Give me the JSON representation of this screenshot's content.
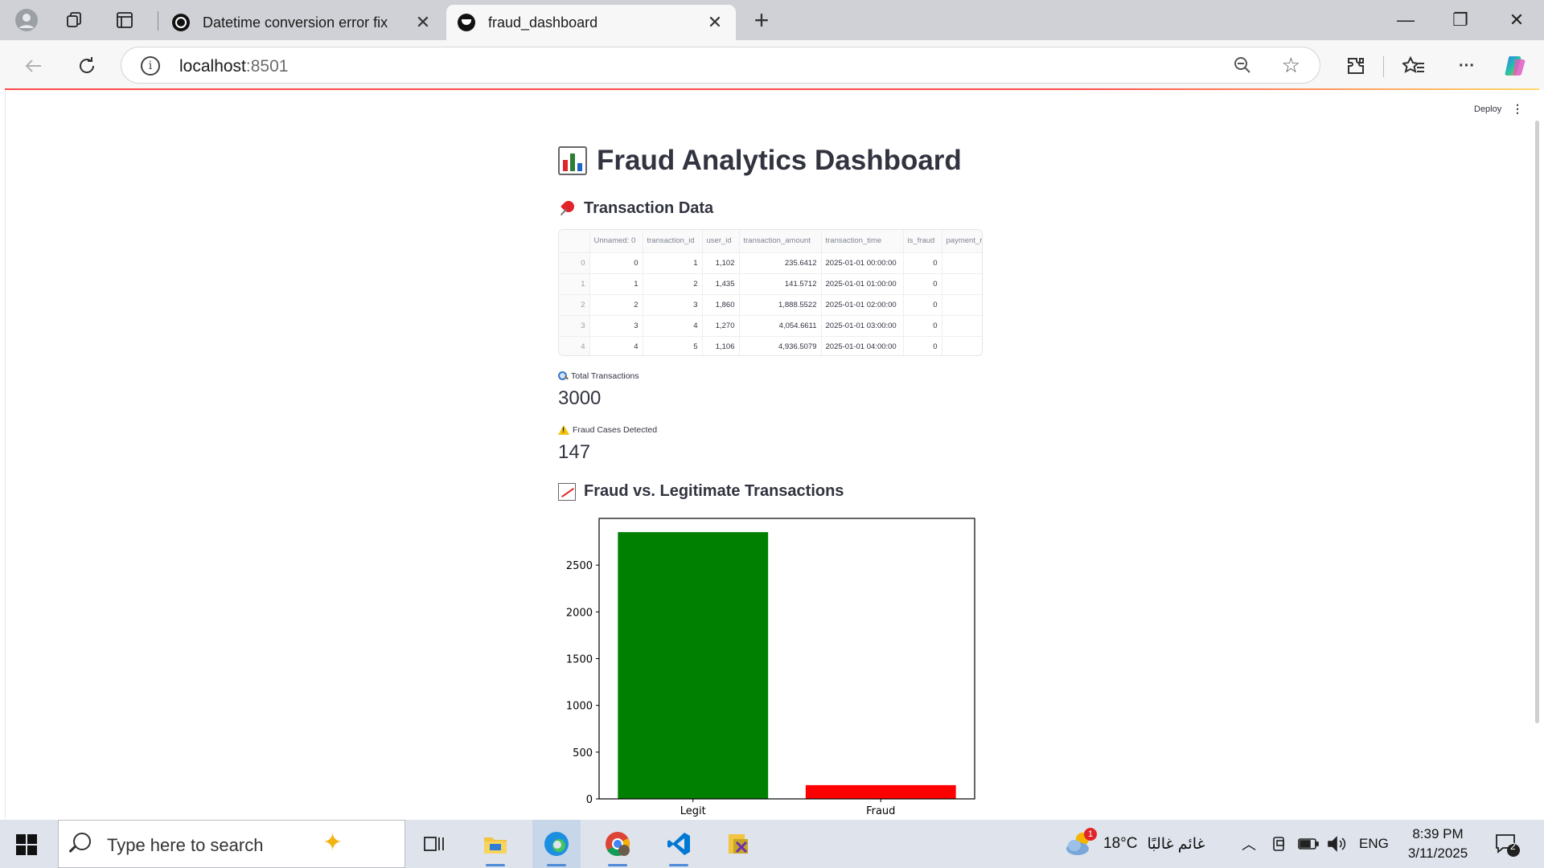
{
  "browser": {
    "tabs": [
      {
        "title": "Datetime conversion error fix",
        "active": false
      },
      {
        "title": "fraud_dashboard",
        "active": true
      }
    ],
    "address": {
      "host": "localhost",
      "port": ":8501"
    }
  },
  "app": {
    "deploy_label": "Deploy",
    "menu_icon": "kebab-icon",
    "title": "Fraud Analytics Dashboard",
    "section_data": "Transaction Data",
    "table": {
      "columns": [
        "",
        "Unnamed: 0",
        "transaction_id",
        "user_id",
        "transaction_amount",
        "transaction_time",
        "is_fraud",
        "payment_r"
      ],
      "rows": [
        [
          "0",
          "0",
          "1",
          "1,102",
          "235.6412",
          "2025-01-01 00:00:00",
          "0",
          ""
        ],
        [
          "1",
          "1",
          "2",
          "1,435",
          "141.5712",
          "2025-01-01 01:00:00",
          "0",
          ""
        ],
        [
          "2",
          "2",
          "3",
          "1,860",
          "1,888.5522",
          "2025-01-01 02:00:00",
          "0",
          ""
        ],
        [
          "3",
          "3",
          "4",
          "1,270",
          "4,054.6611",
          "2025-01-01 03:00:00",
          "0",
          ""
        ],
        [
          "4",
          "4",
          "5",
          "1,106",
          "4,936.5079",
          "2025-01-01 04:00:00",
          "0",
          ""
        ]
      ]
    },
    "metrics": [
      {
        "label": "Total Transactions",
        "value": "3000",
        "icon": "magnifier-icon"
      },
      {
        "label": "Fraud Cases Detected",
        "value": "147",
        "icon": "warning-icon"
      }
    ],
    "section_chart": "Fraud vs. Legitimate Transactions"
  },
  "chart_data": {
    "type": "bar",
    "categories": [
      "Legit",
      "Fraud"
    ],
    "values": [
      2853,
      147
    ],
    "colors": [
      "#008000",
      "#ff0000"
    ],
    "ylim": [
      0,
      3000
    ],
    "yticks": [
      0,
      500,
      1000,
      1500,
      2000,
      2500
    ],
    "grid": false
  },
  "taskbar": {
    "search_placeholder": "Type here to search",
    "weather_temp": "18°C",
    "weather_text": "غائم غالبًا",
    "weather_badge": "1",
    "language": "ENG",
    "time": "8:39 PM",
    "date": "3/11/2025",
    "notifications": "2"
  }
}
